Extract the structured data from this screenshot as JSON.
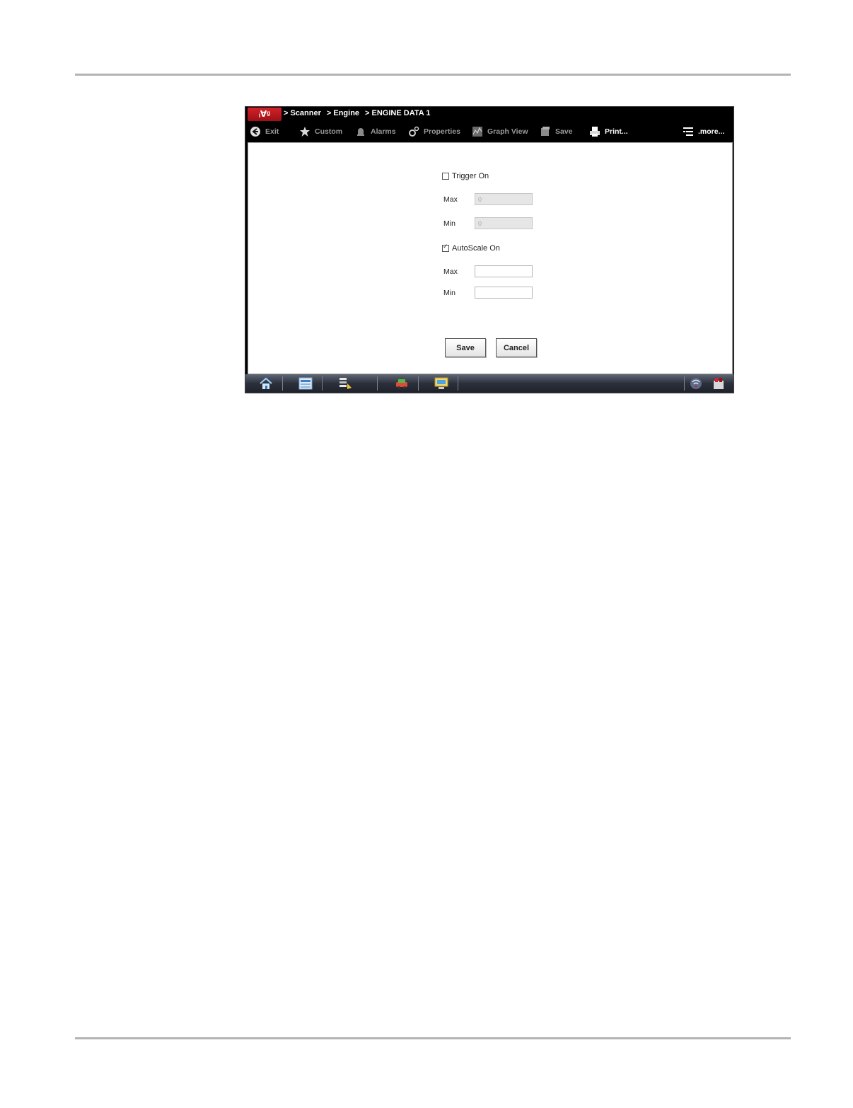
{
  "app": {
    "logo_text": "ᵢ∀ᵍ",
    "breadcrumbs": [
      "> Scanner",
      "> Engine",
      "> ENGINE DATA 1"
    ]
  },
  "toolbar": {
    "exit": "Exit",
    "custom": "Custom",
    "alarms": "Alarms",
    "properties": "Properties",
    "graph_view": "Graph View",
    "save": "Save",
    "print": "Print...",
    "more": ".more..."
  },
  "form": {
    "trigger_label": "Trigger On",
    "trigger_checked": false,
    "trigger_max_label": "Max",
    "trigger_max_value": "0",
    "trigger_min_label": "Min",
    "trigger_min_value": "0",
    "autoscale_label": "AutoScale On",
    "autoscale_checked": true,
    "autoscale_max_label": "Max",
    "autoscale_max_value": "",
    "autoscale_min_label": "Min",
    "autoscale_min_value": "",
    "save_label": "Save",
    "cancel_label": "Cancel"
  },
  "colors": {
    "brand_red": "#d2232a",
    "toolbar_bg": "#000000",
    "toolbar_text_dim": "#9a9a9a"
  }
}
